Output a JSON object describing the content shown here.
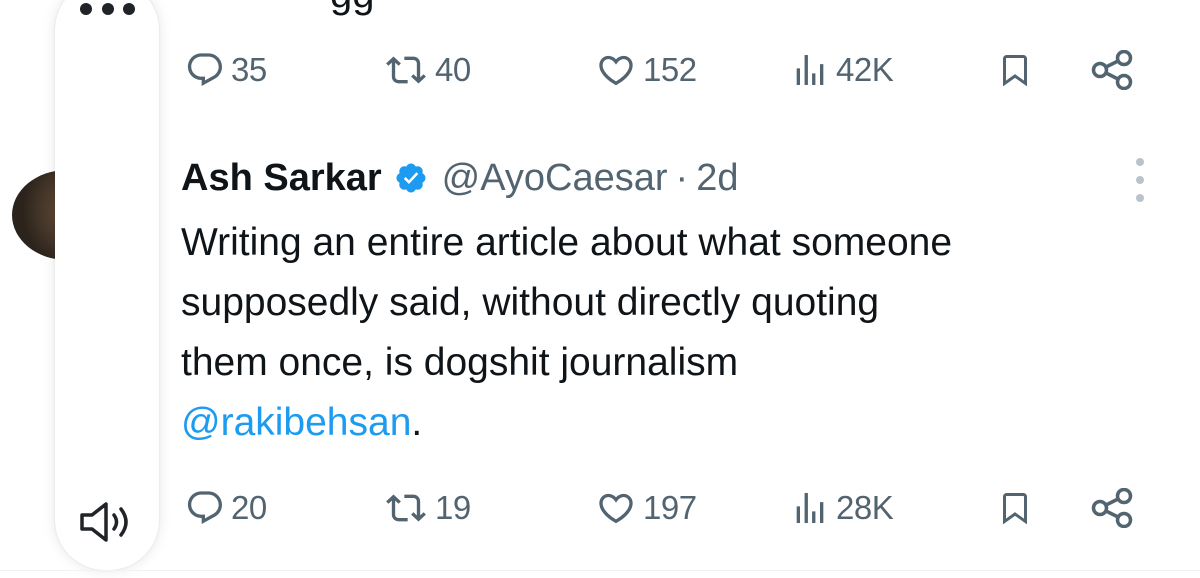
{
  "colors": {
    "accent": "#1d9bf0",
    "muted": "#536471",
    "text": "#0f1419"
  },
  "side_panel": {
    "menu_icon": "more-horizontal-icon",
    "speaker_icon": "speaker-icon"
  },
  "partial_text": "gg",
  "previous_tweet": {
    "replies": "35",
    "reposts": "40",
    "likes": "152",
    "views": "42K"
  },
  "tweet": {
    "author_name": "Ash Sarkar",
    "handle": "@AyoCaesar",
    "separator": "·",
    "time": "2d",
    "body_lines": [
      "Writing an entire article about what someone",
      "supposedly said, without directly quoting",
      "them once, is dogshit journalism"
    ],
    "mention": "@rakibehsan",
    "mention_suffix": ".",
    "replies": "20",
    "reposts": "19",
    "likes": "197",
    "views": "28K"
  },
  "icons": [
    "reply-icon",
    "repost-icon",
    "like-icon",
    "views-icon",
    "bookmark-icon",
    "share-icon",
    "verified-badge-icon",
    "more-options-icon"
  ]
}
